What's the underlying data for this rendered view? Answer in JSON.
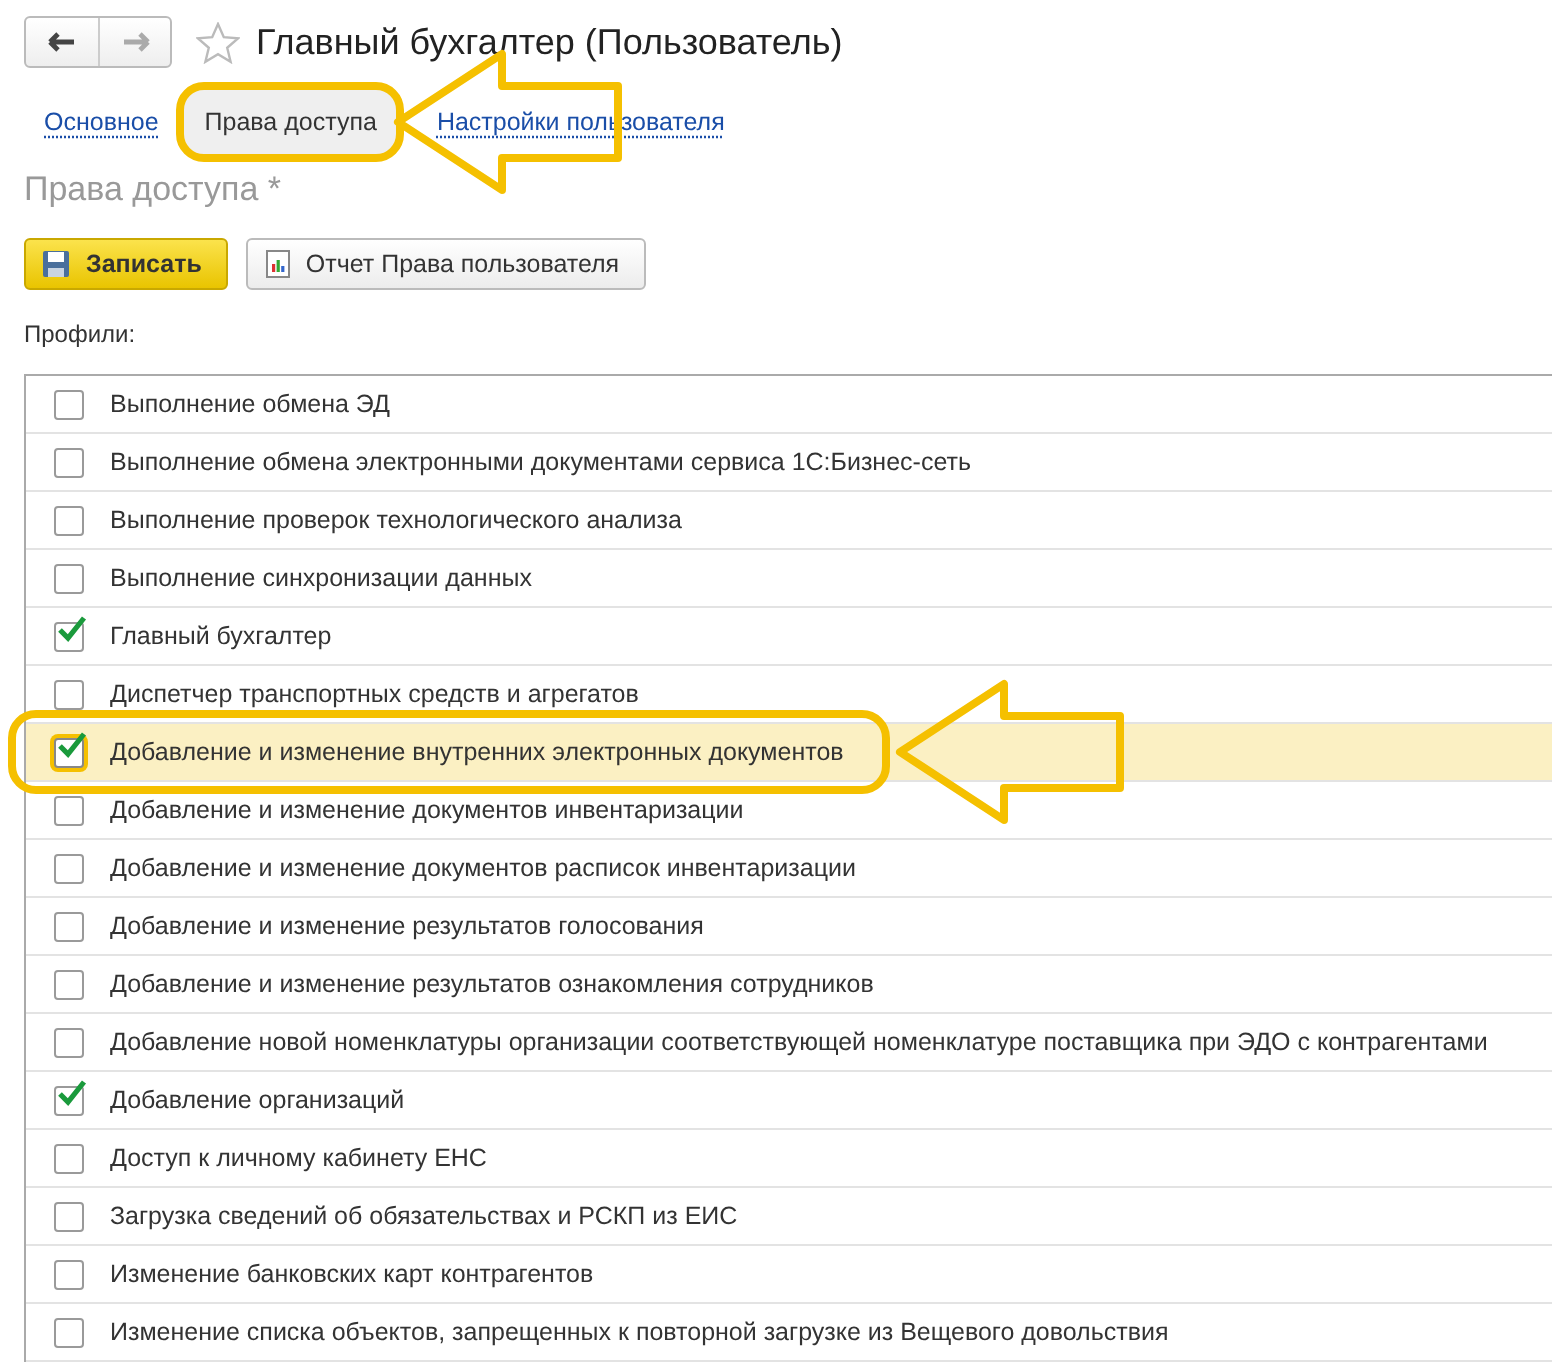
{
  "window": {
    "title": "Главный бухгалтер (Пользователь)"
  },
  "tabs": [
    {
      "label": "Основное",
      "selected": false
    },
    {
      "label": "Права доступа",
      "selected": true
    },
    {
      "label": "Настройки пользователя",
      "selected": false
    }
  ],
  "section_title": "Права доступа *",
  "buttons": [
    {
      "label": "Записать",
      "kind": "primary"
    },
    {
      "label": "Отчет Права пользователя",
      "kind": "report"
    }
  ],
  "profiles_label": "Профили:",
  "profiles": [
    {
      "name": "Выполнение обмена ЭД",
      "checked": false,
      "selected": false
    },
    {
      "name": "Выполнение обмена электронными документами сервиса 1С:Бизнес-сеть",
      "checked": false,
      "selected": false
    },
    {
      "name": "Выполнение проверок технологического анализа",
      "checked": false,
      "selected": false
    },
    {
      "name": "Выполнение синхронизации данных",
      "checked": false,
      "selected": false
    },
    {
      "name": "Главный бухгалтер",
      "checked": true,
      "selected": false
    },
    {
      "name": "Диспетчер транспортных средств и агрегатов",
      "checked": false,
      "selected": false
    },
    {
      "name": "Добавление и изменение внутренних электронных документов",
      "checked": true,
      "selected": true
    },
    {
      "name": "Добавление и изменение документов инвентаризации",
      "checked": false,
      "selected": false
    },
    {
      "name": "Добавление и изменение документов расписок инвентаризации",
      "checked": false,
      "selected": false
    },
    {
      "name": "Добавление и изменение результатов голосования",
      "checked": false,
      "selected": false
    },
    {
      "name": "Добавление и изменение результатов ознакомления сотрудников",
      "checked": false,
      "selected": false
    },
    {
      "name": "Добавление новой номенклатуры организации соответствующей номенклатуре поставщика при ЭДО с контрагентами",
      "checked": false,
      "selected": false
    },
    {
      "name": "Добавление организаций",
      "checked": true,
      "selected": false
    },
    {
      "name": "Доступ к личному кабинету ЕНС",
      "checked": false,
      "selected": false
    },
    {
      "name": "Загрузка сведений об обязательствах и РСКП из ЕИС",
      "checked": false,
      "selected": false
    },
    {
      "name": "Изменение банковских карт контрагентов",
      "checked": false,
      "selected": false
    },
    {
      "name": "Изменение списка объектов, запрещенных к повторной загрузке из Вещевого довольствия",
      "checked": false,
      "selected": false
    }
  ]
}
